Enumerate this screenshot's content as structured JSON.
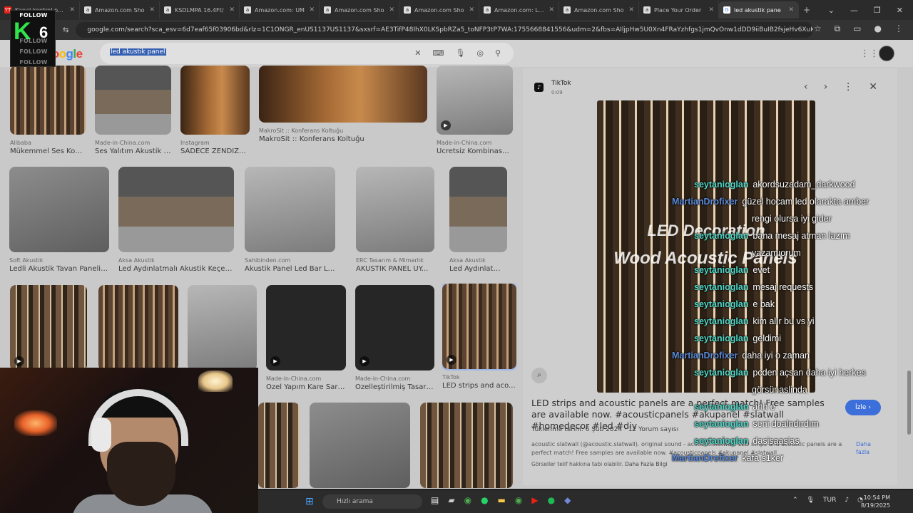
{
  "browser": {
    "tabs": [
      {
        "label": "Kanal kontrol paneli",
        "favicon": "YT"
      },
      {
        "label": "Amazon.com Sho",
        "favicon": "a"
      },
      {
        "label": "KSDLMPA 16.4Ft/",
        "favicon": "a"
      },
      {
        "label": "Amazon.com: UM",
        "favicon": "a"
      },
      {
        "label": "Amazon.com Sho",
        "favicon": "a"
      },
      {
        "label": "Amazon.com Sho",
        "favicon": "a"
      },
      {
        "label": "Amazon.com: LEA",
        "favicon": "a"
      },
      {
        "label": "Amazon.com Sho",
        "favicon": "a"
      },
      {
        "label": "Place Your Order",
        "favicon": "a"
      },
      {
        "label": "led akustik pane",
        "favicon": "G",
        "active": true
      }
    ],
    "url": "google.com/search?sca_esv=6d7eaf65f03906bd&rlz=1C1ONGR_enUS1137US1137&sxsrf=AE3TifP48IhX0LKSpbRZa5_toNFP3tP7WA:1755668841556&udm=2&fbs=AIljpHw5U0Xn4FRaYzhfgs1jmQvOnw1dDD9iiBuIB2fsjeHv6XuKgDzU9KpxZMcpsjQ"
  },
  "google": {
    "logo": "Google",
    "query": "led akustik panel"
  },
  "results": [
    {
      "src": "Alibaba",
      "title": "Mükemmel Ses Kontr...",
      "img": "hand"
    },
    {
      "src": "Made-in-China.com",
      "title": "Ses Yalıtım Akustik P...",
      "img": "office"
    },
    {
      "src": "Instagram",
      "title": "SADECE ZENDIZ...",
      "img": "warm"
    },
    {
      "src": "MakroSit :: Konferans Koltuğu",
      "title": "MakroSit :: Konferans Koltuğu",
      "img": "warm2"
    },
    {
      "src": "Made-in-China.com",
      "title": "Ücretsiz Kombinasyo...",
      "img": "gray"
    },
    {
      "src": "Soft Akustik",
      "title": "Ledli Akustik Tavan Paneli -A...",
      "img": "soft"
    },
    {
      "src": "Aksa Akustik",
      "title": "Led Aydınlatmalı Akustik Keçe Pa...",
      "img": "cafe"
    },
    {
      "src": "Sahibinden.com",
      "title": "Akustik Panel Led Bar Led Lo...",
      "img": "bw"
    },
    {
      "src": "ERC Tasarım & Mimarlık",
      "title": "AKUSTİK PANEL UY...",
      "img": "bar"
    },
    {
      "src": "Aksa Akustik",
      "title": "Led Aydınlatmalı A...",
      "img": "colorful"
    },
    {
      "src": "",
      "title": "",
      "img": "slats"
    },
    {
      "src": "",
      "title": "",
      "img": "reception"
    },
    {
      "src": "",
      "title": "",
      "img": "ring"
    },
    {
      "src": "Made-in-China.com",
      "title": "Özel Yapım Kare Sark...",
      "img": "square"
    },
    {
      "src": "Made-in-China.com",
      "title": "Özelleştirilmiş Tasarım...",
      "img": "hex"
    },
    {
      "src": "TikTok",
      "title": "LED strips and aco...",
      "img": "tiktok"
    },
    {
      "src": "",
      "title": "",
      "img": "slats3"
    },
    {
      "src": "",
      "title": "",
      "img": "lake"
    },
    {
      "src": "",
      "title": "",
      "img": "cabinet"
    }
  ],
  "panel": {
    "source": "TikTok",
    "duration": "0:09",
    "overlay_line1": "LED Decoration",
    "overlay_line2": "Wood Acoustic Panels",
    "description": "LED strips and acoustic panels are a perfect match! Free samples are available now. #acousticpanels #akupanel #slatwall #homedecor #led #diy",
    "watch_label": "İzle",
    "uploaded": "Yüklenme tarihi: 6 Şub 2024",
    "comments": "12 Yorum sayısı",
    "small_description": "acoustic slatwall (@acoustic.slatwall). original sound - acoustic.slatwall. LED strips and acoustic panels are a perfect match! Free samples are available now. #acousticpanels #akupanel #slatwall ...",
    "more": "Daha fazla",
    "credits": "Görseller telif hakkına tabi olabilir.",
    "credits_link": "Daha Fazla Bilgi"
  },
  "chat": [
    {
      "user": "seytanioglan",
      "color": "#4fd8c8",
      "text": "akordsuzadam_darkwood"
    },
    {
      "user": "MartianDrofixer",
      "color": "#5b8ad9",
      "text": "güzel hocam led olarakta amber"
    },
    {
      "user": "",
      "color": "#ffffff",
      "text": "rengi olursa iyi gider"
    },
    {
      "user": "seytanioglan",
      "color": "#4fd8c8",
      "text": "bana mesaj atman lazım"
    },
    {
      "user": "",
      "color": "#ffffff",
      "text": "yazamıorum"
    },
    {
      "user": "seytanioglan",
      "color": "#4fd8c8",
      "text": "evet"
    },
    {
      "user": "seytanioglan",
      "color": "#4fd8c8",
      "text": "mesaj requests"
    },
    {
      "user": "seytanioglan",
      "color": "#4fd8c8",
      "text": "e bak"
    },
    {
      "user": "seytanioglan",
      "color": "#4fd8c8",
      "text": "kim alır bu vs yi"
    },
    {
      "user": "seytanioglan",
      "color": "#4fd8c8",
      "text": "geldimi"
    },
    {
      "user": "MartianDrofixer",
      "color": "#5b8ad9",
      "text": "daha iyi o zaman"
    },
    {
      "user": "seytanioglan",
      "color": "#4fd8c8",
      "text": "pcden açsan daha iyi herkes"
    },
    {
      "user": "",
      "color": "#ffffff",
      "text": "görsünaslinda"
    },
    {
      "user": "seytanioglan",
      "color": "#4fd8c8",
      "text": "ahh e"
    },
    {
      "user": "seytanioglan",
      "color": "#4fd8c8",
      "text": "seni doalndırdım"
    },
    {
      "user": "seytanioglan",
      "color": "#4fd8c8",
      "text": "dasisaasias"
    },
    {
      "user": "MartianDrofixer",
      "color": "#5b8ad9",
      "text": "kafa s1ker"
    }
  ],
  "overlay_logo": {
    "follow": "FOLLOW",
    "letter": "K",
    "number": "6"
  },
  "taskbar": {
    "search_placeholder": "Hızlı arama",
    "lang": "TUR",
    "time": "10:54 PM",
    "date": "8/19/2025"
  },
  "colors": {
    "tiktok_user": "#4fd8c8",
    "martian_user": "#5b8ad9",
    "accent": "#3c6fd9"
  }
}
